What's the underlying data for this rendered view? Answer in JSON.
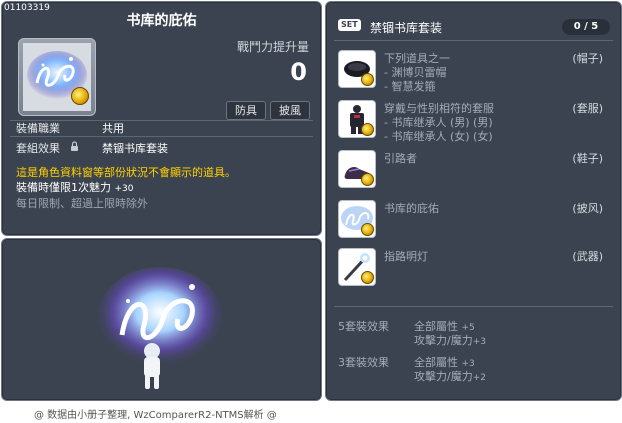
{
  "item": {
    "id": "01103319",
    "title": "书库的庇佑",
    "power_label": "戰鬥力提升量",
    "power_value": "0",
    "tags": [
      "防具",
      "披風"
    ],
    "job_label": "裝備職業",
    "job_value": "共用",
    "set_label": "套組效果",
    "set_value": "禁锢书库套装",
    "warning": "這是角色資料窗等部份狀況不會顯示的道具。",
    "limit_text": "裝備時僅限1次魅力",
    "limit_value": "+30",
    "limit_note": "每日限制、超過上限時除外"
  },
  "set": {
    "badge": "SET",
    "title": "禁锢书库套装",
    "count": "0 / 5",
    "items": [
      {
        "name": "下列道具之一",
        "subs": [
          "- 渊博贝雷帽",
          "- 智慧发箍"
        ],
        "type": "(帽子)",
        "icon": "beret-icon"
      },
      {
        "name": "穿戴与性别相符的套服",
        "subs": [
          "- 书库继承人 (男) (男)",
          "- 书库继承人 (女) (女)"
        ],
        "type": "(套服)",
        "icon": "outfit-icon"
      },
      {
        "name": "引路者",
        "subs": [],
        "type": "(鞋子)",
        "icon": "shoes-icon"
      },
      {
        "name": "书库的庇佑",
        "subs": [],
        "type": "(披风)",
        "icon": "cape-icon"
      },
      {
        "name": "指路明灯",
        "subs": [],
        "type": "(武器)",
        "icon": "lamp-staff-icon"
      }
    ],
    "effects": [
      {
        "label": "5套裝效果",
        "stats": [
          {
            "name": "全部屬性",
            "value": "+5"
          },
          {
            "name": "攻擊力/魔力",
            "value": "+3"
          }
        ]
      },
      {
        "label": "3套裝效果",
        "stats": [
          {
            "name": "全部屬性",
            "value": "+3"
          },
          {
            "name": "攻擊力/魔力",
            "value": "+2"
          }
        ]
      }
    ]
  },
  "footer": "@ 数据由小册子整理, WzComparerR2-NTMS解析 @"
}
